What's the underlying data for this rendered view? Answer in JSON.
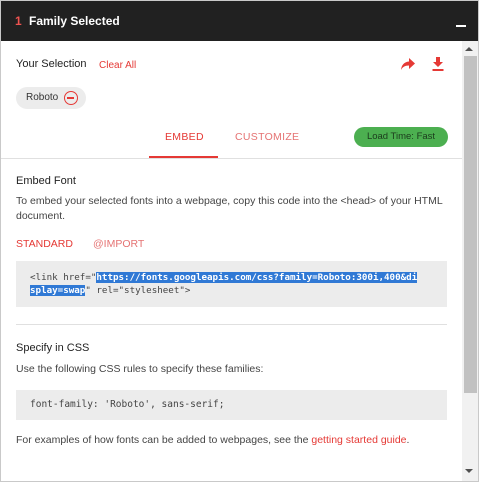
{
  "header": {
    "count": "1",
    "title": "Family Selected"
  },
  "selection": {
    "label": "Your Selection",
    "clear_all": "Clear All",
    "chip_label": "Roboto"
  },
  "tabs": {
    "embed": "EMBED",
    "customize": "CUSTOMIZE"
  },
  "load_time": "Load Time: Fast",
  "embed_font": {
    "title": "Embed Font",
    "description": "To embed your selected fonts into a webpage, copy this code into the <head> of your HTML document.",
    "standard_tab": "STANDARD",
    "import_tab": "@IMPORT",
    "code_prefix": "<link href=\"",
    "code_url_part1": "https://fonts.googleapis.com/css?family=Roboto:300i,400&di",
    "code_url_part2": "splay=swap",
    "code_suffix": "\" rel=\"stylesheet\">"
  },
  "css": {
    "title": "Specify in CSS",
    "description": "Use the following CSS rules to specify these families:",
    "code": "font-family: 'Roboto', sans-serif;"
  },
  "footer": {
    "text_before": "For examples of how fonts can be added to webpages, see the ",
    "link": "getting started guide",
    "text_after": "."
  },
  "colors": {
    "accent": "#e53935",
    "header_bg": "#212121",
    "badge_bg": "#4caf50",
    "selection_highlight": "#3079d5"
  },
  "icons": [
    "minimize-icon",
    "share-icon",
    "download-icon",
    "remove-circle-icon",
    "scroll-up-arrow-icon",
    "scroll-down-arrow-icon"
  ]
}
